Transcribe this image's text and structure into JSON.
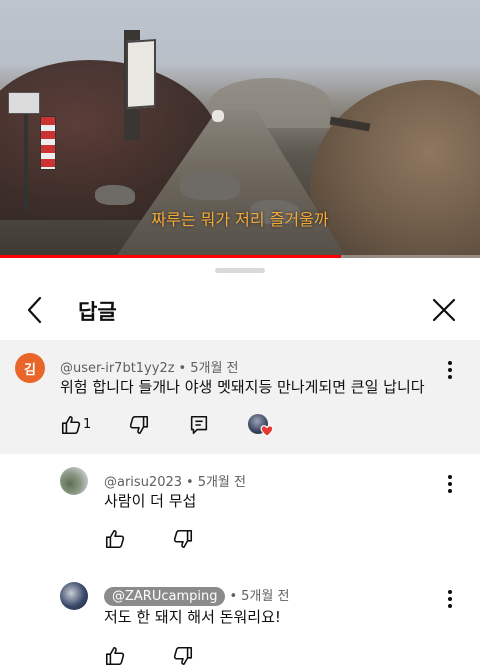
{
  "video": {
    "subtitle": "짜루는 뭐가 저리 즐거울까",
    "progress": 0.71,
    "progress_color": "#ff0000",
    "subtitle_color": "#f3a93a"
  },
  "sheet": {
    "title": "답글",
    "back_icon": "chevron-left-icon",
    "close_icon": "close-icon"
  },
  "comments": [
    {
      "avatar_letter": "김",
      "avatar_color": "#e8662a",
      "author": "@user-ir7bt1yy2z",
      "time": "5개월 전",
      "text": "위험 합니다 들개나 야생 멧돼지등 만나게되면 큰일 납니다",
      "likes": "1",
      "has_creator_heart": true
    },
    {
      "author": "@arisu2023",
      "time": "5개월 전",
      "text": "사람이 더 무섭"
    },
    {
      "author": "@ZARUcamping",
      "time": "5개월 전",
      "text": "저도 한 돼지 해서 돈워리요!",
      "is_creator": true
    }
  ]
}
